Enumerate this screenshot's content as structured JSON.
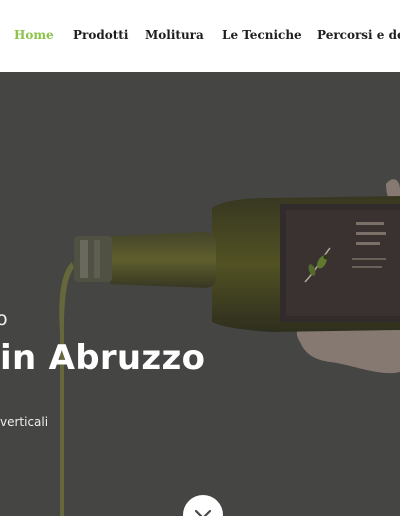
{
  "nav": {
    "items": [
      {
        "label": "Home",
        "active": true
      },
      {
        "label": "Prodotti",
        "active": false
      },
      {
        "label": "Molitura",
        "active": false
      },
      {
        "label": "Le Tecniche",
        "active": false
      },
      {
        "label": "Percorsi e deg",
        "active": false
      }
    ]
  },
  "hero": {
    "eyebrow": "o",
    "title": "in Abruzzo",
    "subtitle": "verticali"
  },
  "colors": {
    "accent": "#8bc34a",
    "overlay": "#4a4a49",
    "oil": "#6b6a1a"
  },
  "icons": {
    "scroll": "chevron-down-icon"
  }
}
